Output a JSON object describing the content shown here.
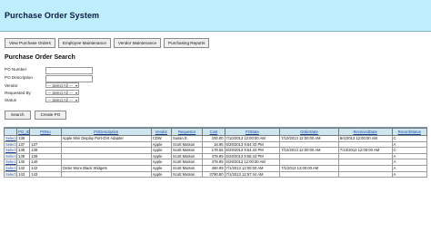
{
  "app": {
    "title": "Purchase Order System"
  },
  "nav": {
    "items": [
      {
        "label": "View Purchase Orders"
      },
      {
        "label": "Employee Maintenance"
      },
      {
        "label": "Vendor Maintenance"
      },
      {
        "label": "Purchasing Reports"
      }
    ]
  },
  "search": {
    "title": "Purchase Order Search",
    "po_number_label": "PO Number",
    "po_number_value": "",
    "po_description_label": "PO Description",
    "po_description_value": "",
    "vendor_label": "Vendor",
    "vendor_value": "--- Select All ---",
    "requested_by_label": "Requested By",
    "requested_by_value": "--- Select All ---",
    "status_label": "Status",
    "status_value": "--- Select All ---",
    "search_button": "Search",
    "create_button": "Create PO"
  },
  "grid": {
    "columns": [
      "PO_ID",
      "PONo",
      "PODescription",
      "Vendor",
      "Requestor",
      "Cost",
      "PODate",
      "OrderDate",
      "ReceivedDate",
      "RecordStatus"
    ],
    "rows": [
      {
        "link": "Select",
        "cells": [
          "136",
          "136",
          "Apple Mini Display Port-DVI Adapter",
          "CDW",
          "Susan E.",
          "100.00",
          "7/10/2013 12:00:00 AM",
          "7/10/2013 12:00:00 AM",
          "8/4/2013 12:00:00 AM",
          "C"
        ]
      },
      {
        "link": "Select",
        "cells": [
          "137",
          "137",
          "",
          "Apple",
          "Scott Matson",
          "18.95",
          "6/28/2013 9:54:43 PM",
          "",
          "",
          "A"
        ]
      },
      {
        "link": "Select",
        "cells": [
          "138",
          "138",
          "",
          "Apple",
          "Scott Matson",
          "178.55",
          "6/29/2013 9:54:43 PM",
          "7/10/2013 12:00:00 AM",
          "7/10/2013 12:00:00 AM",
          "C"
        ]
      },
      {
        "link": "Select",
        "cells": [
          "139",
          "139",
          "",
          "Apple",
          "Scott Matson",
          "478.99",
          "6/29/2013 9:55:43 PM",
          "",
          "",
          "A"
        ]
      },
      {
        "link": "Select",
        "cells": [
          "140",
          "140",
          "",
          "Apple",
          "Scott Matson",
          "478.99",
          "6/29/2013 12:00:00 AM",
          "",
          "",
          "A"
        ]
      },
      {
        "link": "Select",
        "cells": [
          "142",
          "142",
          "Order More Black Widgets",
          "Apple",
          "Scott Matson",
          "460.99",
          "7/1/2013 12:00:00 AM",
          "7/1/2013 12:00:00 AM",
          "",
          "A"
        ]
      },
      {
        "link": "Select",
        "cells": [
          "143",
          "143",
          "",
          "Apple",
          "Scott Matson",
          "3790.50",
          "7/1/2013 12:57:44 AM",
          "",
          "",
          "A"
        ]
      }
    ]
  },
  "colors": {
    "header_bg": "#bfefff",
    "link": "#1d4aa0",
    "selection": "#3b6fd6"
  }
}
